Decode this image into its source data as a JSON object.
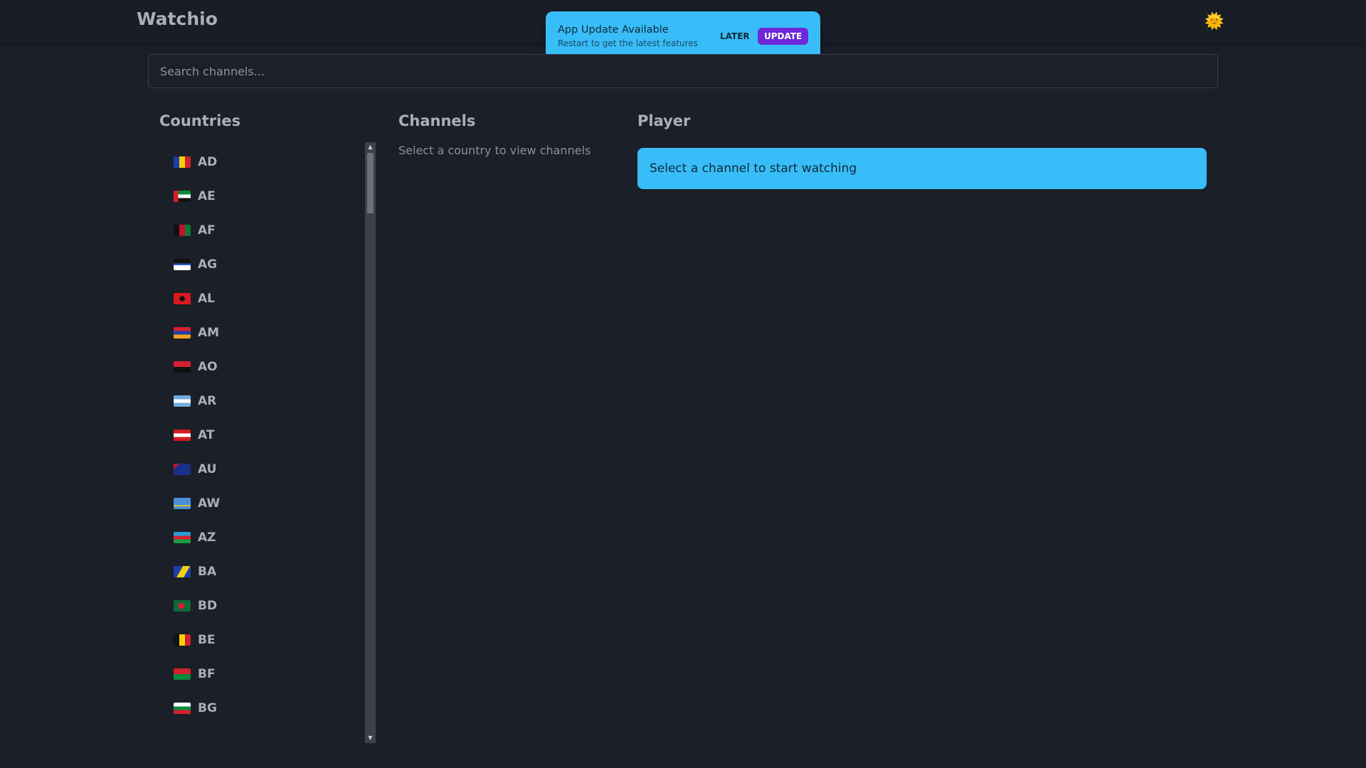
{
  "app": {
    "title": "Watchio",
    "theme_icon": "sun-icon",
    "theme_glyph": "🌞"
  },
  "toast": {
    "title": "App Update Available",
    "subtitle": "Restart to get the latest features",
    "later_label": "LATER",
    "update_label": "UPDATE",
    "colors": {
      "background": "#38bdf8",
      "update_button": "#6d28d9"
    }
  },
  "search": {
    "placeholder": "Search channels...",
    "value": ""
  },
  "countries": {
    "heading": "Countries",
    "items": [
      {
        "code": "AD",
        "flag": "andorra-flag"
      },
      {
        "code": "AE",
        "flag": "uae-flag"
      },
      {
        "code": "AF",
        "flag": "afghanistan-flag"
      },
      {
        "code": "AG",
        "flag": "antigua-flag"
      },
      {
        "code": "AL",
        "flag": "albania-flag"
      },
      {
        "code": "AM",
        "flag": "armenia-flag"
      },
      {
        "code": "AO",
        "flag": "angola-flag"
      },
      {
        "code": "AR",
        "flag": "argentina-flag"
      },
      {
        "code": "AT",
        "flag": "austria-flag"
      },
      {
        "code": "AU",
        "flag": "australia-flag"
      },
      {
        "code": "AW",
        "flag": "aruba-flag"
      },
      {
        "code": "AZ",
        "flag": "azerbaijan-flag"
      },
      {
        "code": "BA",
        "flag": "bosnia-flag"
      },
      {
        "code": "BD",
        "flag": "bangladesh-flag"
      },
      {
        "code": "BE",
        "flag": "belgium-flag"
      },
      {
        "code": "BF",
        "flag": "burkina-faso-flag"
      },
      {
        "code": "BG",
        "flag": "bulgaria-flag"
      }
    ]
  },
  "channels": {
    "heading": "Channels",
    "empty_message": "Select a country to view channels"
  },
  "player": {
    "heading": "Player",
    "message": "Select a channel to start watching"
  }
}
